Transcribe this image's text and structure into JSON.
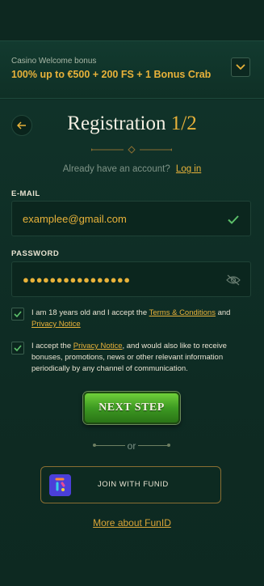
{
  "bonus": {
    "label": "Casino Welcome bonus",
    "title": "100% up to €500 + 200 FS + 1 Bonus Crab",
    "toggle_icon": "chevron-down-icon"
  },
  "header": {
    "back_icon": "arrow-left-icon",
    "title": "Registration",
    "step": "1/2"
  },
  "login": {
    "prompt": "Already have an account?",
    "link": "Log in"
  },
  "form": {
    "email_label": "E-MAIL",
    "email_value": "examplee@gmail.com",
    "email_status_icon": "checkmark-icon",
    "password_label": "PASSWORD",
    "password_value": "●●●●●●●●●●●●●●●●",
    "password_toggle_icon": "eye-slash-icon"
  },
  "consents": [
    {
      "checked": true,
      "text_before": "I am 18 years old and I accept the ",
      "link1": "Terms & Conditions",
      "text_middle": " and ",
      "link2": "Privacy Notice"
    },
    {
      "checked": true,
      "text_before": "I accept the ",
      "link": "Privacy Notice",
      "text_after": ", and would also like to receive bonuses, promotions, news or other relevant information periodically by any channel of communication."
    }
  ],
  "actions": {
    "next_step": "NEXT STEP",
    "or": "or",
    "funid": "JOIN WITH FUNID",
    "more_funid": "More about FunID"
  },
  "colors": {
    "accent": "#e8b23a",
    "background": "#0e2b23",
    "button_green": "#3d9a22",
    "funid_brand": "#4b3fd8"
  }
}
